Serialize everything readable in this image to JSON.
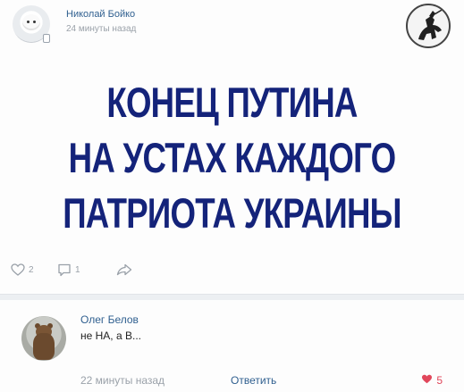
{
  "post": {
    "author": "Николай Бойко",
    "time": "24 минуты назад",
    "text_lines": [
      "КОНЕЦ ПУТИНА",
      "НА УСТАХ КАЖДОГО",
      "ПАТРИОТА УКРАИНЫ"
    ],
    "text_color": "#14237a"
  },
  "actions": {
    "likes_count": "2",
    "comments_count": "1",
    "icons": {
      "like": "heart-outline-icon",
      "comment": "comment-icon",
      "share": "share-arrow-icon"
    }
  },
  "comment": {
    "author": "Олег Белов",
    "text": "не НА, а В...",
    "time": "22 минуты назад",
    "reply_label": "Ответить",
    "likes_count": "5",
    "like_color": "#e1475b"
  },
  "colors": {
    "link": "#2f5f8f",
    "muted": "#9aa1a9",
    "separator": "#eceff2"
  }
}
